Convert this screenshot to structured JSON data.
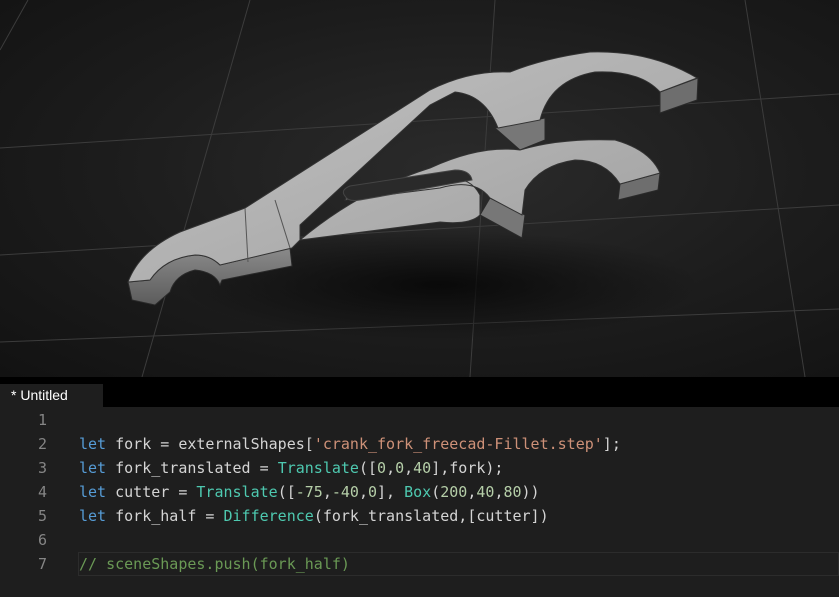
{
  "viewport": {
    "model_icon": "crank-fork-3d-model",
    "colors": {
      "background": "#1c1c1c",
      "model_top": "#b8b8b8",
      "model_side": "#7a7a7a",
      "grid": "#3a3a3a"
    }
  },
  "editor": {
    "tab_label": "* Untitled",
    "colors": {
      "keyword": "#569cd6",
      "function": "#4ec9b0",
      "string": "#ce9178",
      "number": "#b5cea8",
      "comment": "#6a9955",
      "text": "#d4d4d4",
      "line_number": "#858585"
    },
    "lines": [
      {
        "number": "1",
        "tokens": []
      },
      {
        "number": "2",
        "tokens": [
          {
            "t": "let",
            "c": "kw"
          },
          {
            "t": " fork = externalShapes[",
            "c": "txt"
          },
          {
            "t": "'crank_fork_freecad-Fillet.step'",
            "c": "str"
          },
          {
            "t": "];",
            "c": "txt"
          }
        ]
      },
      {
        "number": "3",
        "tokens": [
          {
            "t": "let",
            "c": "kw"
          },
          {
            "t": " fork_translated = ",
            "c": "txt"
          },
          {
            "t": "Translate",
            "c": "fn"
          },
          {
            "t": "([",
            "c": "txt"
          },
          {
            "t": "0",
            "c": "num"
          },
          {
            "t": ",",
            "c": "txt"
          },
          {
            "t": "0",
            "c": "num"
          },
          {
            "t": ",",
            "c": "txt"
          },
          {
            "t": "40",
            "c": "num"
          },
          {
            "t": "],fork);",
            "c": "txt"
          }
        ]
      },
      {
        "number": "4",
        "tokens": [
          {
            "t": "let",
            "c": "kw"
          },
          {
            "t": " cutter = ",
            "c": "txt"
          },
          {
            "t": "Translate",
            "c": "fn"
          },
          {
            "t": "([",
            "c": "txt"
          },
          {
            "t": "-75",
            "c": "num"
          },
          {
            "t": ",",
            "c": "txt"
          },
          {
            "t": "-40",
            "c": "num"
          },
          {
            "t": ",",
            "c": "txt"
          },
          {
            "t": "0",
            "c": "num"
          },
          {
            "t": "], ",
            "c": "txt"
          },
          {
            "t": "Box",
            "c": "fn"
          },
          {
            "t": "(",
            "c": "txt"
          },
          {
            "t": "200",
            "c": "num"
          },
          {
            "t": ",",
            "c": "txt"
          },
          {
            "t": "40",
            "c": "num"
          },
          {
            "t": ",",
            "c": "txt"
          },
          {
            "t": "80",
            "c": "num"
          },
          {
            "t": "))",
            "c": "txt"
          }
        ]
      },
      {
        "number": "5",
        "tokens": [
          {
            "t": "let",
            "c": "kw"
          },
          {
            "t": " fork_half = ",
            "c": "txt"
          },
          {
            "t": "Difference",
            "c": "fn"
          },
          {
            "t": "(fork_translated,[cutter])",
            "c": "txt"
          }
        ]
      },
      {
        "number": "6",
        "tokens": []
      },
      {
        "number": "7",
        "current": true,
        "tokens": [
          {
            "t": "// sceneShapes.push(fork_half)",
            "c": "cmt"
          }
        ]
      }
    ]
  }
}
